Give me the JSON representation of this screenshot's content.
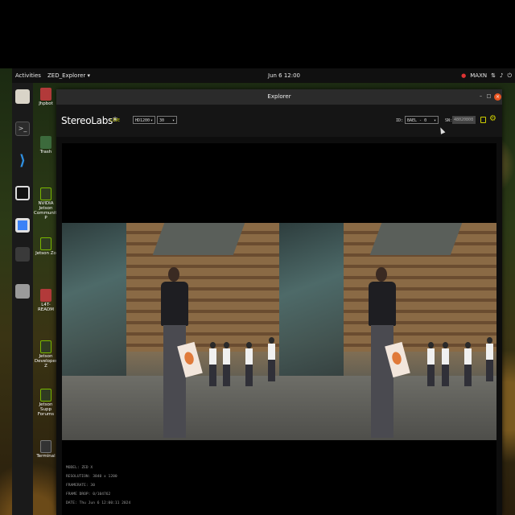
{
  "topbar": {
    "activities": "Activities",
    "app_menu": "ZED_Explorer ▾",
    "clock": "Jun 6  12:00",
    "power_mode": "MAXN",
    "tray_icons": [
      "nvidia-icon",
      "network-icon",
      "volume-icon",
      "power-icon"
    ]
  },
  "dock": {
    "apps": [
      "Files",
      "Terminal",
      "Visual Studio Code",
      "OBS Studio",
      "Chromium",
      "Show Applications",
      "Disks"
    ]
  },
  "desktop_icons": [
    {
      "label": "Jhpbot"
    },
    {
      "label": "Trash"
    },
    {
      "label": "NVIDIA Jetson Community P"
    },
    {
      "label": "Jetson Zo"
    },
    {
      "label": "L4T-READM"
    },
    {
      "label": "Jetson Developer Z"
    },
    {
      "label": "Jetson Supp Forums"
    },
    {
      "label": "Terminal"
    }
  ],
  "window": {
    "title": "Explorer",
    "controls": {
      "minimize": "–",
      "maximize": "□",
      "close": "×"
    }
  },
  "app": {
    "logo": "StereoLabs*",
    "live_label": "LIVE",
    "resolution_select": "HD1200",
    "fps_select": "30",
    "id_label": "ID:",
    "id_select": "BAEL - 0",
    "sn_label": "SN:",
    "sn_value": "48020808"
  },
  "info": {
    "model": "MODEL: ZED X",
    "resolution": "RESOLUTION: 3840 x 1200",
    "framerate": "FRAMERATE: 30",
    "frame_drop": "FRAME DROP: 0/104762",
    "date": "DATE: Thu Jun 6 12:00:11 2024"
  },
  "colors": {
    "accent": "#c8d000",
    "close_button": "#e95420",
    "window_bg": "#0d0d0d"
  }
}
